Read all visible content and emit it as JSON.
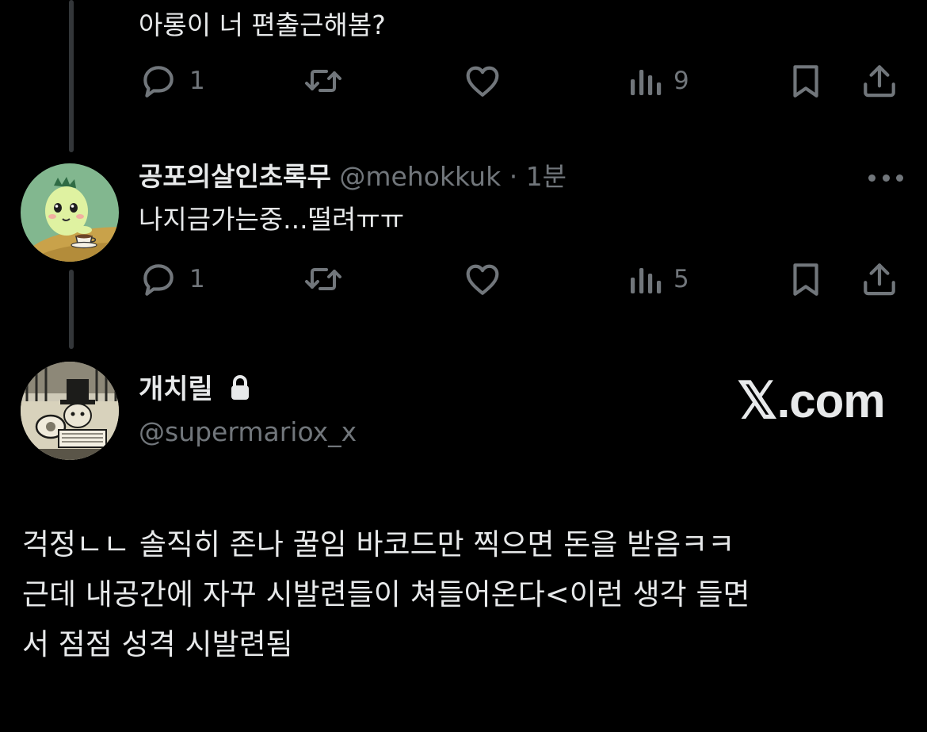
{
  "reply_1": {
    "text": "아롱이 너 편출근해봄?",
    "actions": {
      "reply_count": "1",
      "retweet_count": "",
      "like_count": "",
      "views_count": "9"
    }
  },
  "reply_2": {
    "display_name": "공포의살인초록무",
    "handle": "@mehokkuk",
    "separator": "·",
    "time": "1분",
    "text": "나지금가는중...떨려ㅠㅠ",
    "actions": {
      "reply_count": "1",
      "retweet_count": "",
      "like_count": "",
      "views_count": "5"
    }
  },
  "main_tweet": {
    "display_name": "개치릴",
    "handle": "@supermariox_x",
    "protected": true,
    "text_lines": [
      "걱정ㄴㄴ 솔직히 존나 꿀임 바코드만 찍으면 돈을 받음ㅋㅋ",
      "근데 내공간에 자꾸 시발련들이 쳐들어온다<이런 생각 들면",
      "서 점점 성격 시발련됨"
    ]
  },
  "watermark": {
    "logo_letter": "𝕏",
    "suffix": ".com"
  },
  "icons": {
    "reply": "reply-icon",
    "retweet": "retweet-icon",
    "like": "heart-icon",
    "views": "views-icon",
    "bookmark": "bookmark-icon",
    "share": "share-icon",
    "more": "more-icon",
    "lock": "lock-icon"
  },
  "colors": {
    "background": "#000000",
    "text_primary": "#e7e9ea",
    "text_secondary": "#71767b",
    "thread_line": "#333639"
  }
}
